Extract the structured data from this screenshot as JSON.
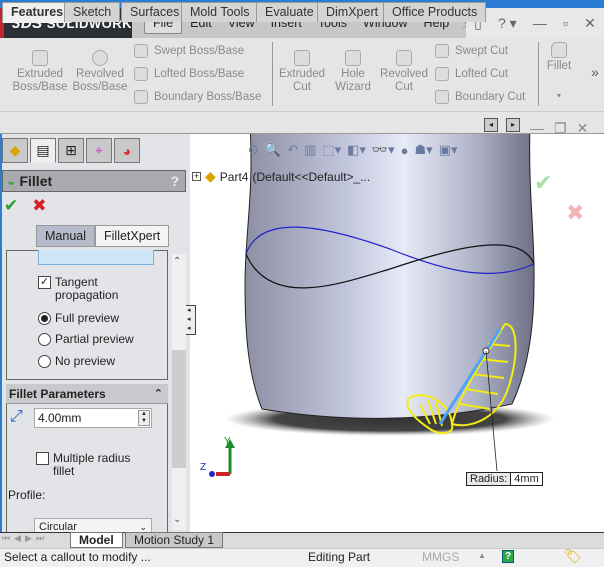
{
  "app": {
    "brand": "SOLIDWORKS",
    "brand_mark": "3DS",
    "accent_color": "#c0282d"
  },
  "menubar": {
    "items": [
      "File",
      "Edit",
      "View",
      "Insert",
      "Tools",
      "Window",
      "Help"
    ],
    "active": "File"
  },
  "window_controls": {
    "help_label": "?",
    "minimize": "—",
    "restore": "▫",
    "close": "✕"
  },
  "ribbon": {
    "boss_group": {
      "extruded": "Extruded Boss/Base",
      "extruded_l1": "Extruded",
      "extruded_l2": "Boss/Base",
      "revolved_l1": "Revolved",
      "revolved_l2": "Boss/Base",
      "swept": "Swept Boss/Base",
      "lofted": "Lofted Boss/Base",
      "boundary": "Boundary Boss/Base"
    },
    "cut_group": {
      "extruded_l1": "Extruded",
      "extruded_l2": "Cut",
      "hole_l1": "Hole",
      "hole_l2": "Wizard",
      "revolved_l1": "Revolved",
      "revolved_l2": "Cut",
      "swept": "Swept Cut",
      "lofted": "Lofted Cut",
      "boundary": "Boundary Cut"
    },
    "fillet": "Fillet",
    "more": "»"
  },
  "command_tabs": [
    {
      "label": "Features",
      "active": true
    },
    {
      "label": "Sketch"
    },
    {
      "label": "Surfaces"
    },
    {
      "label": "Mold Tools"
    },
    {
      "label": "Evaluate"
    },
    {
      "label": "DimXpert"
    },
    {
      "label": "Office Products"
    }
  ],
  "property_manager": {
    "title": "Fillet",
    "help": "?",
    "ok": "✔",
    "cancel": "✖",
    "modes": {
      "manual": "Manual",
      "xpert": "FilletXpert",
      "selected": "Manual"
    },
    "tangent_propagation": {
      "label_l1": "Tangent",
      "label_l2": "propagation",
      "checked": true
    },
    "preview": {
      "options": [
        "Full preview",
        "Partial preview",
        "No preview"
      ],
      "selected": "Full preview"
    },
    "fillet_parameters": {
      "header": "Fillet Parameters",
      "radius": "4.00mm",
      "multiple_radius_l1": "Multiple radius",
      "multiple_radius_l2": "fillet",
      "multiple_radius_checked": false,
      "profile_label": "Profile:",
      "profile_value": "Circular"
    }
  },
  "feature_tree": {
    "root": "Part4",
    "config": "(Default<<Default>_..."
  },
  "viewport": {
    "callout_label": "Radius:",
    "callout_value": "4mm",
    "triad": {
      "y": "Y",
      "z": "Z"
    },
    "confirm_ok": "✔",
    "confirm_cancel": "✖"
  },
  "bottom_tabs": [
    "Model",
    "Motion Study 1"
  ],
  "status": {
    "message": "Select a callout to modify ...",
    "mode": "Editing Part",
    "units": "MMGS",
    "help": "?"
  }
}
